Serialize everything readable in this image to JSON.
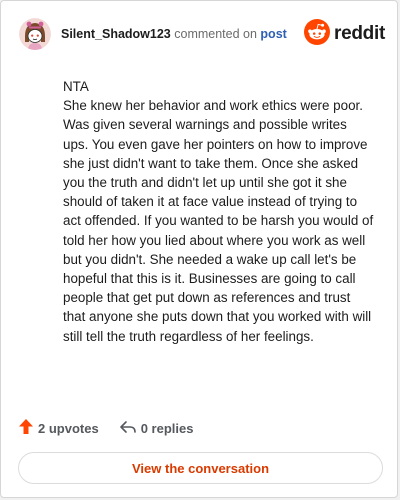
{
  "header": {
    "username": "Silent_Shadow123",
    "verb": "commented on",
    "post_link": "post",
    "brand": "reddit"
  },
  "comment": {
    "paragraphs": [
      "NTA",
      "She knew her behavior and work ethics were poor. Was given several warnings and possible writes ups. You even gave her pointers on how to improve she just didn't want to take them. Once she asked you the truth and didn't let up until she got it she should of taken it at face value instead of trying to act offended. If you wanted to be harsh you would of told her how you lied about where you work as well but you didn't. She needed a wake up call let's be hopeful that this is it. Businesses are going to call people that get put down as references and trust that anyone she puts down that you worked with will still tell the truth regardless of her feelings."
    ]
  },
  "actions": {
    "upvotes": "2 upvotes",
    "replies": "0 replies"
  },
  "cta": {
    "label": "View the conversation"
  },
  "colors": {
    "accent": "#d93a00",
    "upvote": "#ff4500",
    "link": "#2f5fb3",
    "brand_orange": "#ff4500"
  },
  "icons": {
    "avatar": "snoo-avatar-icon",
    "brand": "reddit-logo-icon",
    "upvote": "upvote-arrow-icon",
    "reply": "reply-arrow-icon"
  }
}
